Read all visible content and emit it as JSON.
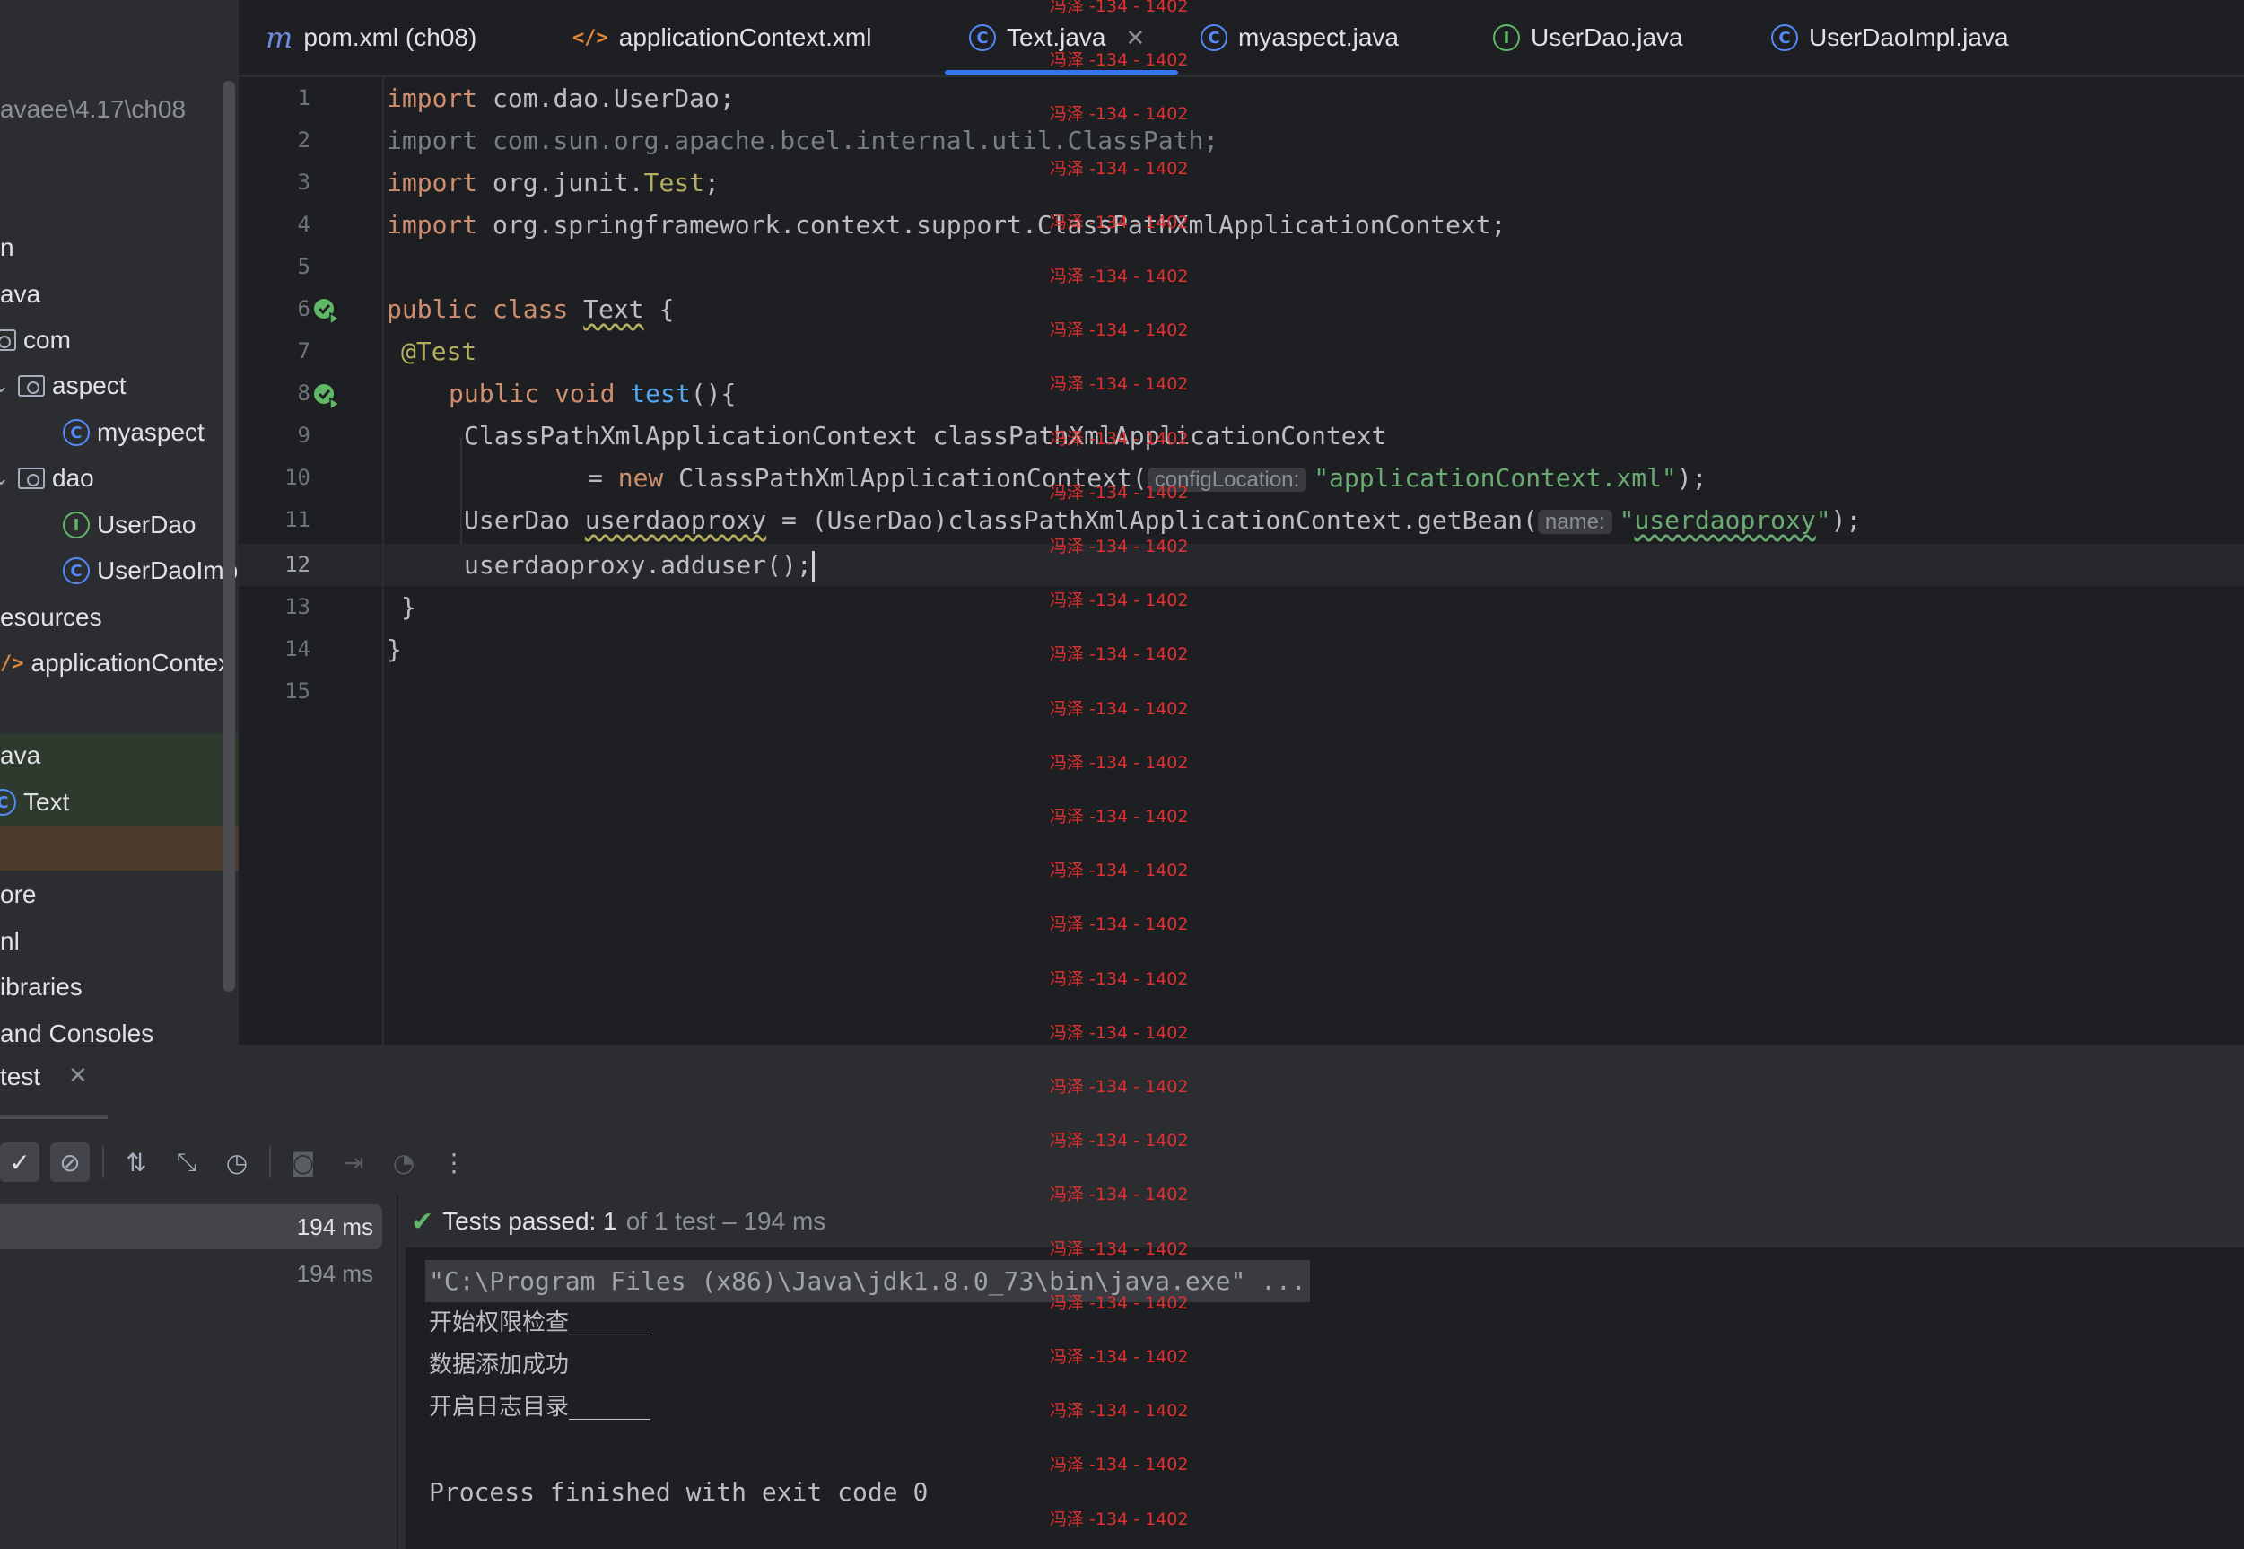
{
  "sidebar": {
    "path_text": "avaee\\4.17\\ch08",
    "items": [
      {
        "label": "n"
      },
      {
        "label": "ava"
      },
      {
        "label": "com"
      },
      {
        "label": "aspect"
      },
      {
        "label": "myaspect"
      },
      {
        "label": "dao"
      },
      {
        "label": "UserDao"
      },
      {
        "label": "UserDaoImp"
      },
      {
        "label": "esources"
      },
      {
        "label": "applicationContex"
      },
      {
        "label": "ava"
      },
      {
        "label": "Text"
      },
      {
        "label": "ore"
      },
      {
        "label": "nl"
      },
      {
        "label": "ibraries"
      },
      {
        "label": "and Consoles"
      }
    ]
  },
  "tabs": [
    {
      "label": "pom.xml (ch08)",
      "icon": "maven-icon"
    },
    {
      "label": "applicationContext.xml",
      "icon": "xml-icon"
    },
    {
      "label": "Text.java",
      "icon": "class-icon",
      "active": true
    },
    {
      "label": "myaspect.java",
      "icon": "class-icon"
    },
    {
      "label": "UserDao.java",
      "icon": "interface-icon"
    },
    {
      "label": "UserDaoImpl.java",
      "icon": "class-icon"
    }
  ],
  "editor": {
    "line_numbers": [
      "1",
      "2",
      "3",
      "4",
      "5",
      "6",
      "7",
      "8",
      "9",
      "10",
      "11",
      "12",
      "13",
      "14",
      "15"
    ],
    "current_line": "12",
    "code": {
      "l1_kw": "import",
      "l1_rest": " com.dao.UserDao;",
      "l2": "import com.sun.org.apache.bcel.internal.util.ClassPath;",
      "l3_kw": "import",
      "l3_a": " org.junit.",
      "l3_ann": "Test",
      "l3_b": ";",
      "l4_kw": "import",
      "l4_rest": " org.springframework.context.support.ClassPathXmlApplicationContext;",
      "l6_kw": "public class ",
      "l6_name": "Text",
      "l6_rest": " {",
      "l7": "@Test",
      "l8_kw": "public void ",
      "l8_fn": "test",
      "l8_rest": "(){",
      "l9": "ClassPathXmlApplicationContext classPathXmlApplicationContext",
      "l10_a": "= ",
      "l10_kw": "new",
      "l10_b": " ClassPathXmlApplicationContext(",
      "l10_hint": "configLocation:",
      "l10_str": "\"applicationContext.xml\"",
      "l10_c": ");",
      "l11_a": "UserDao ",
      "l11_var": "userdaoproxy",
      "l11_b": " = (UserDao)classPathXmlApplicationContext.getBean(",
      "l11_hint": "name:",
      "l11_q1": "\"",
      "l11_str": "userdaoproxy",
      "l11_q2": "\"",
      "l11_c": ");",
      "l12": "userdaoproxy.adduser();",
      "l13": "}",
      "l14": "}"
    }
  },
  "watermark": "冯泽 -134 - 1402",
  "run_panel": {
    "tab_label": "test",
    "tree_rows": [
      {
        "time": "194 ms"
      },
      {
        "time": "194 ms"
      }
    ],
    "status": {
      "main": "Tests passed: 1",
      "sub": "of 1 test – 194 ms"
    },
    "console": [
      "\"C:\\Program Files (x86)\\Java\\jdk1.8.0_73\\bin\\java.exe\" ...",
      "开始权限检查_______",
      "数据添加成功",
      "开启日志目录_______",
      "",
      "Process finished with exit code 0"
    ]
  },
  "colors": {
    "accent": "#3574f0",
    "keyword": "#cf8e6d",
    "string": "#6aab73",
    "watermark": "#e03030",
    "pass": "#5fb865"
  }
}
